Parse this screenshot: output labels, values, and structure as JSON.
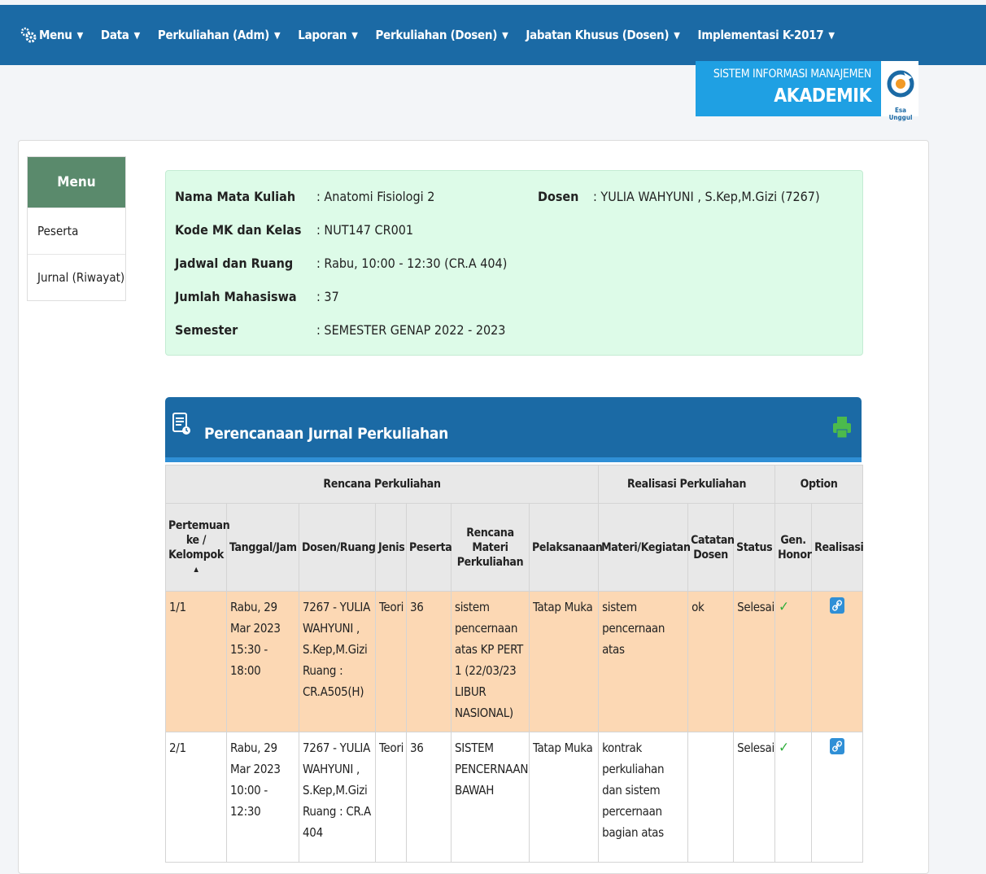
{
  "nav": {
    "items": [
      "Menu",
      "Data",
      "Perkuliahan (Adm)",
      "Laporan",
      "Perkuliahan (Dosen)",
      "Jabatan Khusus (Dosen)",
      "Implementasi K-2017"
    ]
  },
  "brand": {
    "subtitle": "SISTEM INFORMASI MANAJEMEN",
    "title": "AKADEMIK",
    "logo_text": "Esa Unggul"
  },
  "sidebar": {
    "header": "Menu",
    "items": [
      "Peserta",
      "Jurnal (Riwayat)"
    ]
  },
  "course": {
    "rows": [
      {
        "label": "Nama Mata Kuliah",
        "value": ": Anatomi Fisiologi 2"
      },
      {
        "label": "Kode MK dan Kelas",
        "value": ": NUT147 CR001"
      },
      {
        "label": "Jadwal dan Ruang",
        "value": ": Rabu, 10:00 - 12:30 (CR.A 404)"
      },
      {
        "label": "Jumlah Mahasiswa",
        "value": ": 37"
      },
      {
        "label": "Semester",
        "value": ": SEMESTER GENAP 2022 - 2023"
      }
    ],
    "dosen_label": "Dosen",
    "dosen_value": ":  YULIA WAHYUNI , S.Kep,M.Gizi (7267)"
  },
  "jurnal": {
    "title": "Perencanaan Jurnal Perkuliahan",
    "group_headers": {
      "rencana": "Rencana Perkuliahan",
      "realisasi": "Realisasi Perkuliahan",
      "option": "Option"
    },
    "columns": {
      "pertemuan": "Pertemuan ke / Kelompok",
      "tanggal": "Tanggal/Jam",
      "dosen": "Dosen/Ruang",
      "jenis": "Jenis",
      "peserta": "Peserta",
      "materi": "Rencana Materi Perkuliahan",
      "pelaksanaan": "Pelaksanaan",
      "kegiatan": "Materi/Kegiatan",
      "catatan": "Catatan Dosen",
      "status": "Status",
      "honor": "Gen. Honor",
      "realisasi": "Realisasi"
    },
    "rows": [
      {
        "pertemuan": "1/1",
        "tanggal": "Rabu, 29 Mar 2023",
        "jam": "15:30 - 18:00",
        "dosen": "7267 - YULIA WAHYUNI , S.Kep,M.Gizi",
        "ruang": "Ruang : CR.A505(H)",
        "jenis": "Teori",
        "peserta": "36",
        "materi": "sistem pencernaan atas KP PERT 1 (22/03/23 LIBUR NASIONAL)",
        "pelaksanaan": "Tatap Muka",
        "kegiatan": "sistem pencernaan atas",
        "catatan": "ok",
        "status": "Selesai",
        "honor": "✓"
      },
      {
        "pertemuan": "2/1",
        "tanggal": "Rabu, 29 Mar 2023",
        "jam": "10:00 - 12:30",
        "dosen": "7267 - YULIA WAHYUNI , S.Kep,M.Gizi",
        "ruang": "Ruang : CR.A 404",
        "jenis": "Teori",
        "peserta": "36",
        "materi": "SISTEM PENCERNAAN BAWAH",
        "pelaksanaan": "Tatap Muka",
        "kegiatan": "kontrak perkuliahan dan sistem percernaan bagian atas",
        "catatan": "",
        "status": "Selesai",
        "honor": "✓"
      }
    ]
  }
}
